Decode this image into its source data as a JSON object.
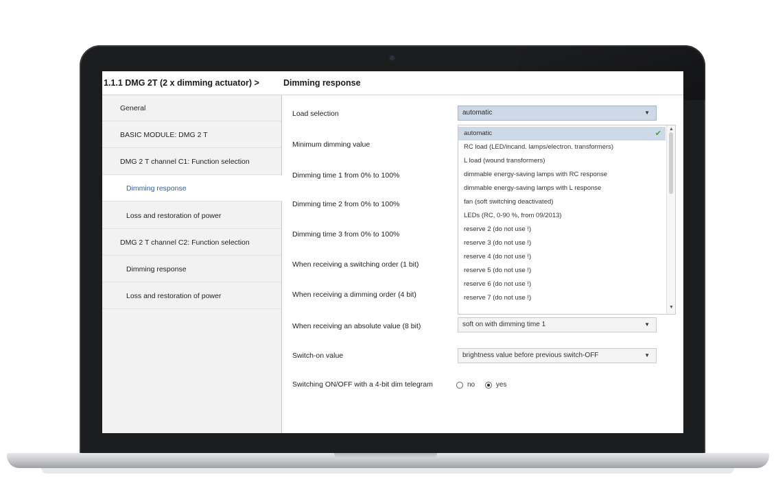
{
  "breadcrumb": {
    "parent": "1.1.1 DMG 2T (2 x dimming actuator) >",
    "current": "Dimming response"
  },
  "sidebar": {
    "items": [
      {
        "label": "General"
      },
      {
        "label": "BASIC MODULE: DMG 2 T"
      },
      {
        "label": "DMG 2 T channel C1: Function selection"
      },
      {
        "label": "Dimming response"
      },
      {
        "label": "Loss and restoration of power"
      },
      {
        "label": "DMG 2 T channel C2: Function selection"
      },
      {
        "label": "Dimming response"
      },
      {
        "label": "Loss and restoration of power"
      }
    ]
  },
  "params": {
    "load_selection": "Load selection",
    "min_dimming": "Minimum dimming value",
    "dim_time_1": "Dimming time 1 from 0% to 100%",
    "dim_time_2": "Dimming time 2 from 0% to 100%",
    "dim_time_3": "Dimming time 3 from 0% to 100%",
    "switching_order": "When receiving a switching order (1 bit)",
    "dimming_order": "When receiving a dimming order (4 bit)",
    "absolute_value": "When receiving an absolute value (8 bit)",
    "switch_on_value": "Switch-on value",
    "switching_4bit": "Switching ON/OFF with a 4-bit dim telegram"
  },
  "selects": {
    "load_selection": "automatic",
    "absolute_value": "soft on with dimming time 1",
    "switch_on_value": "brightness value before previous switch-OFF"
  },
  "dropdown": {
    "options": [
      "automatic",
      "RC load (LED/incand. lamps/electron. transformers)",
      "L load (wound transformers)",
      "dimmable energy-saving lamps with RC response",
      "dimmable energy-saving lamps with L response",
      "fan (soft switching deactivated)",
      "LEDs (RC, 0-90 %, from 09/2013)",
      "reserve 2 (do not use !)",
      "reserve 3 (do not use !)",
      "reserve 4 (do not use !)",
      "reserve 5 (do not use !)",
      "reserve 6 (do not use !)",
      "reserve 7 (do not use !)"
    ]
  },
  "radio": {
    "no": "no",
    "yes": "yes"
  },
  "icons": {
    "caret": "chevron-down-icon",
    "check": "checkmark-icon"
  },
  "colors": {
    "active_item_text": "#2a5ea8",
    "selected_highlight": "#cdd9e6",
    "check_green": "#4a9a3a"
  }
}
